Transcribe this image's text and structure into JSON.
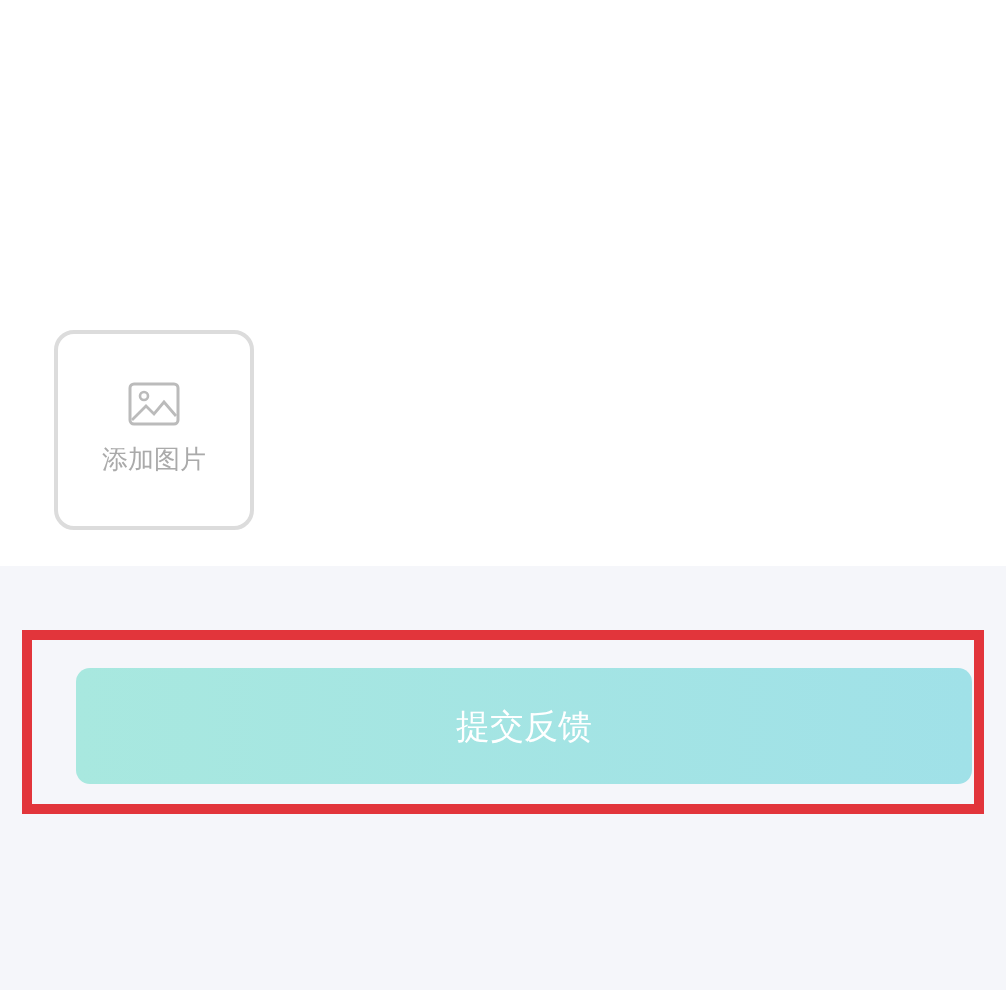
{
  "add_image": {
    "label": "添加图片"
  },
  "submit_button": {
    "label": "提交反馈",
    "disabled": true,
    "highlighted": true
  }
}
